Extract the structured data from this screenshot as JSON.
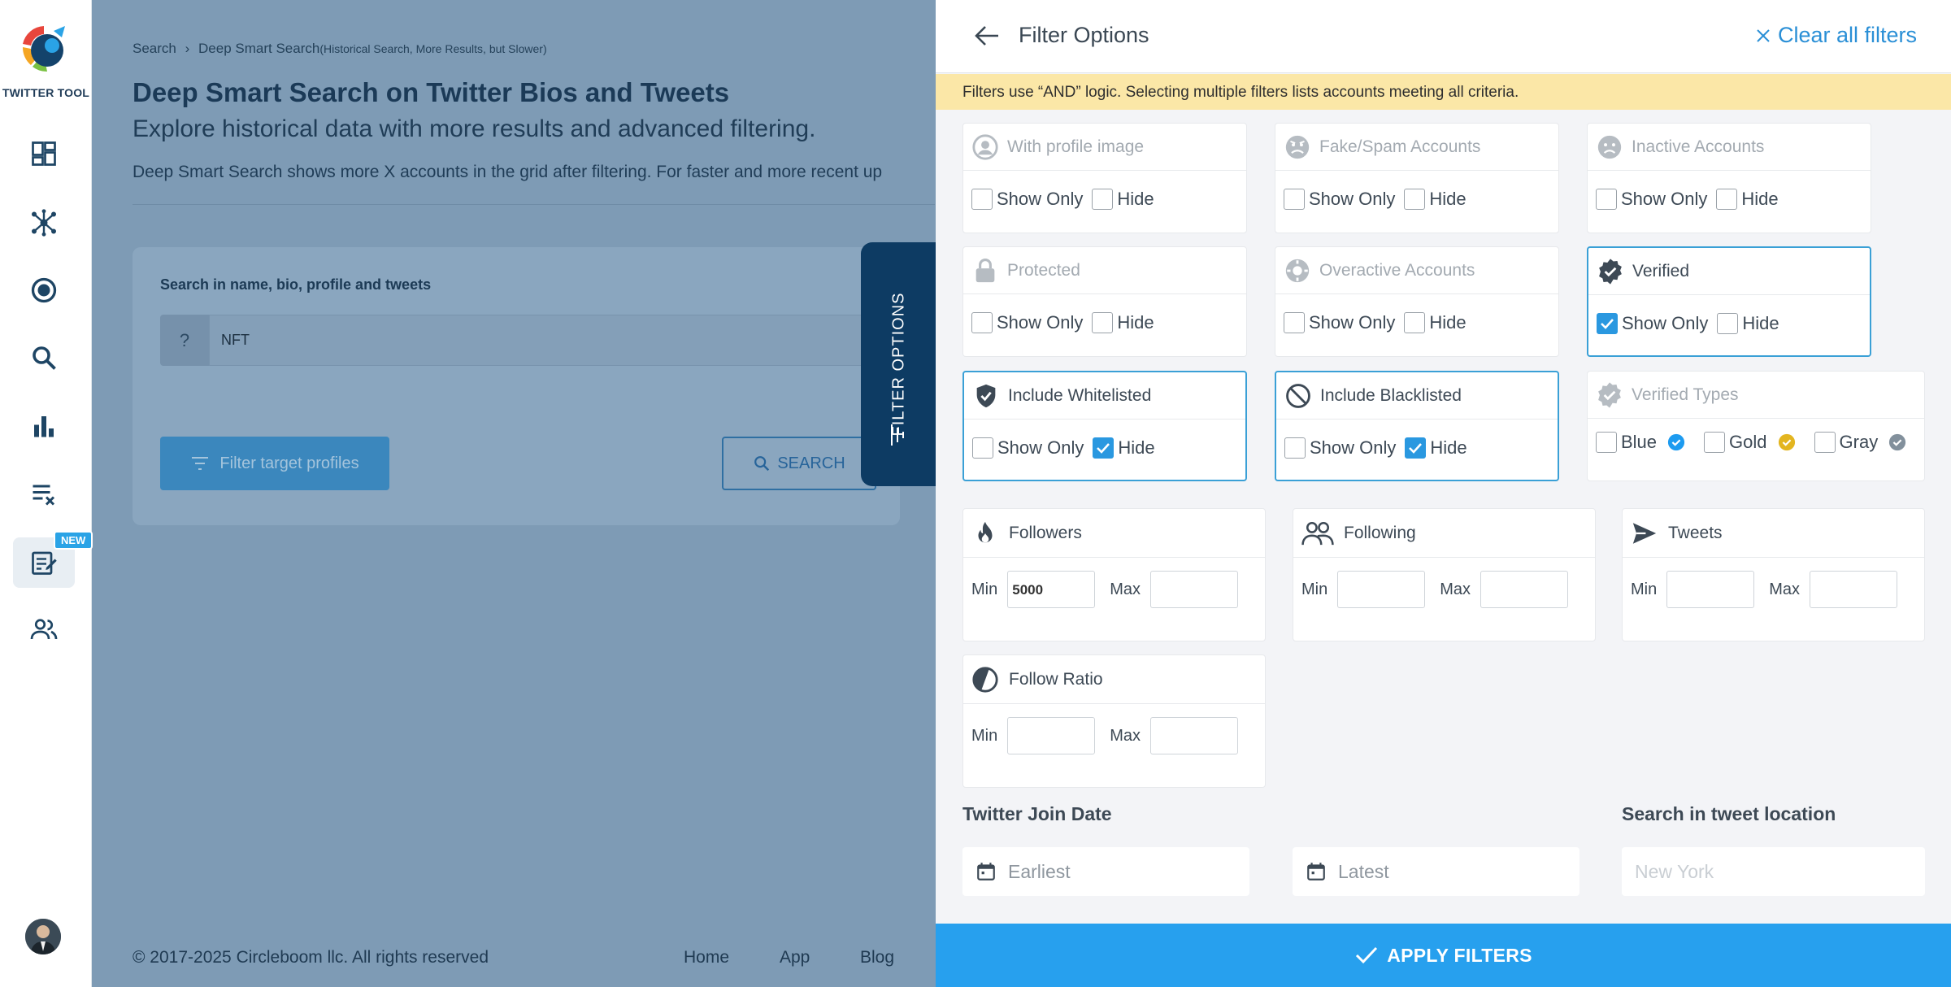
{
  "app": {
    "logo_text": "TWITTER TOOL",
    "new_badge": "NEW"
  },
  "sidebar": {
    "items": [
      {
        "name": "dashboard-icon"
      },
      {
        "name": "network-icon"
      },
      {
        "name": "target-icon"
      },
      {
        "name": "search-icon"
      },
      {
        "name": "bar-chart-icon"
      },
      {
        "name": "clear-list-icon"
      },
      {
        "name": "notes-icon"
      },
      {
        "name": "users-icon"
      }
    ]
  },
  "breadcrumb": {
    "root": "Search",
    "current": "Deep Smart Search",
    "current_note": "(Historical Search, More Results, but Slower)"
  },
  "page": {
    "title": "Deep Smart Search on Twitter Bios and Tweets",
    "subtitle": "Explore historical data with more results and advanced filtering.",
    "description": "Deep Smart Search shows more X accounts in the grid after filtering. For faster and more recent up",
    "search_label": "Search in name, bio, profile and tweets",
    "search_prefix": "?",
    "search_value": "NFT",
    "filter_button": "Filter target profiles",
    "search_button": "SEARCH"
  },
  "footer": {
    "copyright": "© 2017-2025 Circleboom llc. All rights reserved",
    "links": [
      "Home",
      "App",
      "Blog"
    ]
  },
  "tab": {
    "label": "FILTER OPTIONS"
  },
  "panel": {
    "title": "Filter Options",
    "clear_all": "Clear all filters",
    "notice": "Filters use “AND” logic. Selecting multiple filters lists accounts meeting all criteria.",
    "show_only": "Show Only",
    "hide": "Hide",
    "filters": [
      {
        "label": "With profile image",
        "icon": "profile-image-icon",
        "active": false,
        "show_only": false,
        "hide": false
      },
      {
        "label": "Fake/Spam Accounts",
        "icon": "fake-spam-icon",
        "active": false,
        "show_only": false,
        "hide": false
      },
      {
        "label": "Inactive Accounts",
        "icon": "inactive-icon",
        "active": false,
        "show_only": false,
        "hide": false
      },
      {
        "label": "Protected",
        "icon": "lock-icon",
        "active": false,
        "show_only": false,
        "hide": false
      },
      {
        "label": "Overactive Accounts",
        "icon": "overactive-icon",
        "active": false,
        "show_only": false,
        "hide": false
      },
      {
        "label": "Verified",
        "icon": "verified-badge-icon",
        "active": true,
        "show_only": true,
        "hide": false
      },
      {
        "label": "Include Whitelisted",
        "icon": "shield-check-icon",
        "active": true,
        "show_only": false,
        "hide": true
      },
      {
        "label": "Include Blacklisted",
        "icon": "block-icon",
        "active": true,
        "show_only": false,
        "hide": true
      }
    ],
    "verified_types": {
      "label": "Verified Types",
      "options": [
        {
          "label": "Blue",
          "color": "#1d9bf0",
          "checked": false
        },
        {
          "label": "Gold",
          "color": "#e3b520",
          "checked": false
        },
        {
          "label": "Gray",
          "color": "#82909c",
          "checked": false
        }
      ]
    },
    "ranges": {
      "min_label": "Min",
      "max_label": "Max",
      "followers": {
        "label": "Followers",
        "min": "5000",
        "max": ""
      },
      "following": {
        "label": "Following",
        "min": "",
        "max": ""
      },
      "tweets": {
        "label": "Tweets",
        "min": "",
        "max": ""
      },
      "follow_ratio": {
        "label": "Follow Ratio",
        "min": "",
        "max": ""
      }
    },
    "join_date": {
      "title": "Twitter Join Date",
      "earliest_placeholder": "Earliest",
      "latest_placeholder": "Latest"
    },
    "tweet_location": {
      "title": "Search in tweet location",
      "placeholder": "New York"
    },
    "apply_button": "APPLY FILTERS"
  },
  "colors": {
    "accent": "#27a0ee",
    "navy": "#0d3b63",
    "notice": "#fbe7a7"
  }
}
